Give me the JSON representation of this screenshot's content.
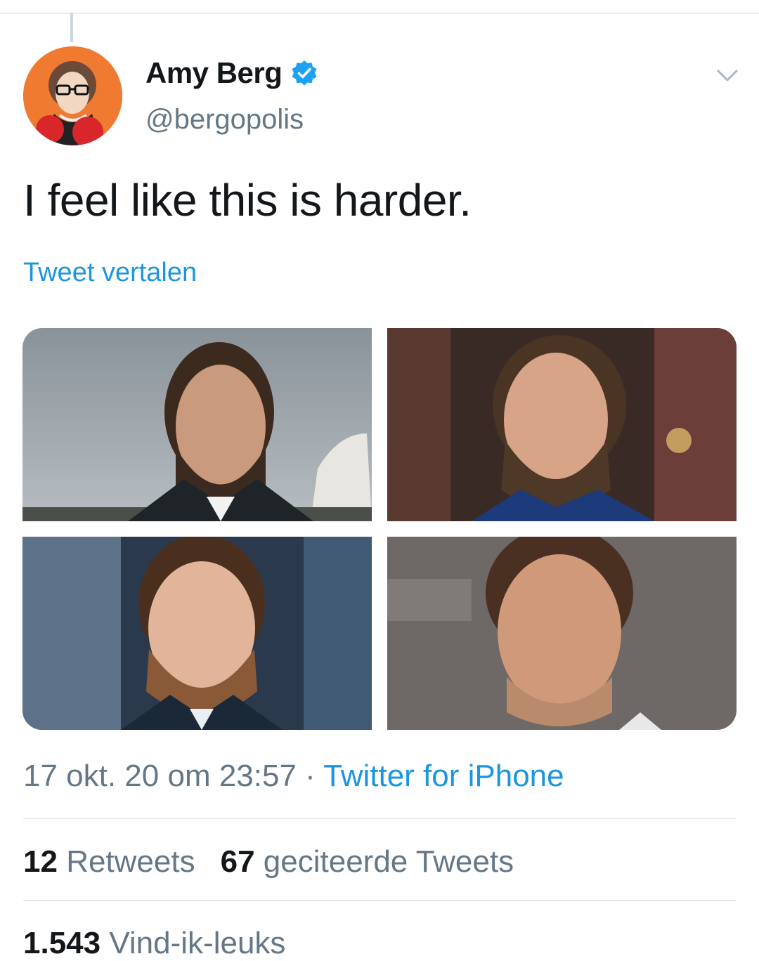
{
  "author": {
    "display_name": "Amy Berg",
    "handle": "@bergopolis",
    "verified": true
  },
  "tweet": {
    "text": "I feel like this is harder.",
    "translate_label": "Tweet vertalen",
    "timestamp": "17 okt. 20 om 23:57",
    "separator": " · ",
    "source": "Twitter for iPhone"
  },
  "media": [
    {
      "description": "photo-1"
    },
    {
      "description": "photo-2"
    },
    {
      "description": "photo-3"
    },
    {
      "description": "photo-4"
    }
  ],
  "stats": {
    "retweets_count": "12",
    "retweets_label": "Retweets",
    "quotes_count": "67",
    "quotes_label": "geciteerde Tweets",
    "likes_count": "1.543",
    "likes_label": "Vind-ik-leuks"
  },
  "colors": {
    "link_blue": "#1b95e0",
    "secondary_text": "#657786",
    "primary_text": "#14171a",
    "divider": "#e6ecf0",
    "verified_blue": "#1da1f2"
  },
  "icons": {
    "verified": "verified-badge-icon",
    "menu": "chevron-down-icon"
  }
}
